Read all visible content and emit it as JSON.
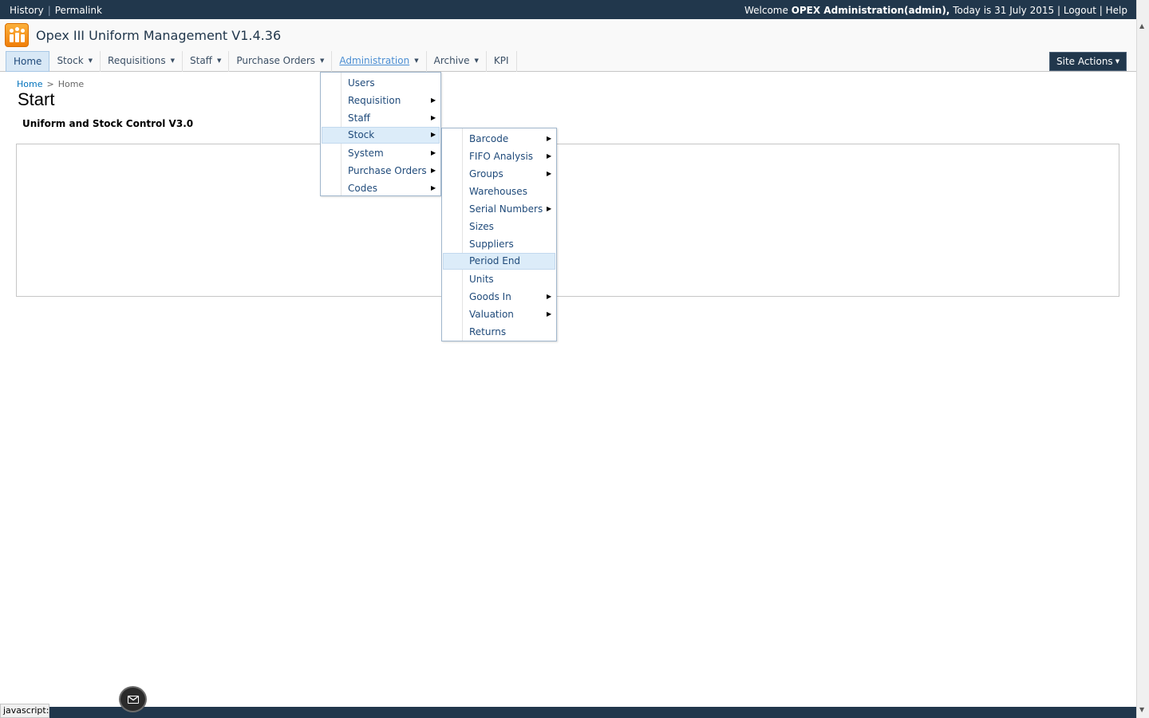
{
  "topbar": {
    "history": "History",
    "permalink": "Permalink",
    "welcome_prefix": "Welcome",
    "user": "OPEX Administration(admin),",
    "date_text": "Today is 31 July 2015",
    "logout": "Logout",
    "help": "Help",
    "separator": "|"
  },
  "site": {
    "title": "Opex III Uniform Management V1.4.36",
    "logo_icon": "people-icon"
  },
  "nav": {
    "items": [
      {
        "label": "Home",
        "has_menu": false
      },
      {
        "label": "Stock",
        "has_menu": true
      },
      {
        "label": "Requisitions",
        "has_menu": true
      },
      {
        "label": "Staff",
        "has_menu": true
      },
      {
        "label": "Purchase Orders",
        "has_menu": true
      },
      {
        "label": "Administration",
        "has_menu": true
      },
      {
        "label": "Archive",
        "has_menu": true
      },
      {
        "label": "KPI",
        "has_menu": false
      }
    ],
    "arrow": "▼",
    "site_actions": "Site Actions"
  },
  "breadcrumb": {
    "root": "Home",
    "sep": ">",
    "current": "Home"
  },
  "page": {
    "title": "Start",
    "subtitle": "Uniform and Stock Control V3.0"
  },
  "admin_menu": {
    "items": [
      {
        "label": "Users",
        "submenu": false
      },
      {
        "label": "Requisition",
        "submenu": true
      },
      {
        "label": "Staff",
        "submenu": true
      },
      {
        "label": "Stock",
        "submenu": true
      },
      {
        "label": "System",
        "submenu": true
      },
      {
        "label": "Purchase Orders",
        "submenu": true
      },
      {
        "label": "Codes",
        "submenu": true
      }
    ],
    "highlighted": "Stock"
  },
  "stock_menu": {
    "items": [
      {
        "label": "Barcode",
        "submenu": true
      },
      {
        "label": "FIFO Analysis",
        "submenu": true
      },
      {
        "label": "Groups",
        "submenu": true
      },
      {
        "label": "Warehouses",
        "submenu": false
      },
      {
        "label": "Serial Numbers",
        "submenu": true
      },
      {
        "label": "Sizes",
        "submenu": false
      },
      {
        "label": "Suppliers",
        "submenu": false
      },
      {
        "label": "Period End",
        "submenu": false
      },
      {
        "label": "Units",
        "submenu": false
      },
      {
        "label": "Goods In",
        "submenu": true
      },
      {
        "label": "Valuation",
        "submenu": true
      },
      {
        "label": "Returns",
        "submenu": false
      }
    ],
    "highlighted": "Period End"
  },
  "submenu_arrow": "▶",
  "status": {
    "text": "javascript:"
  },
  "colors": {
    "topbar": "#21374c",
    "highlight": "#dcecf9",
    "link": "#1f4a7a",
    "logo": "#f07f0a"
  }
}
